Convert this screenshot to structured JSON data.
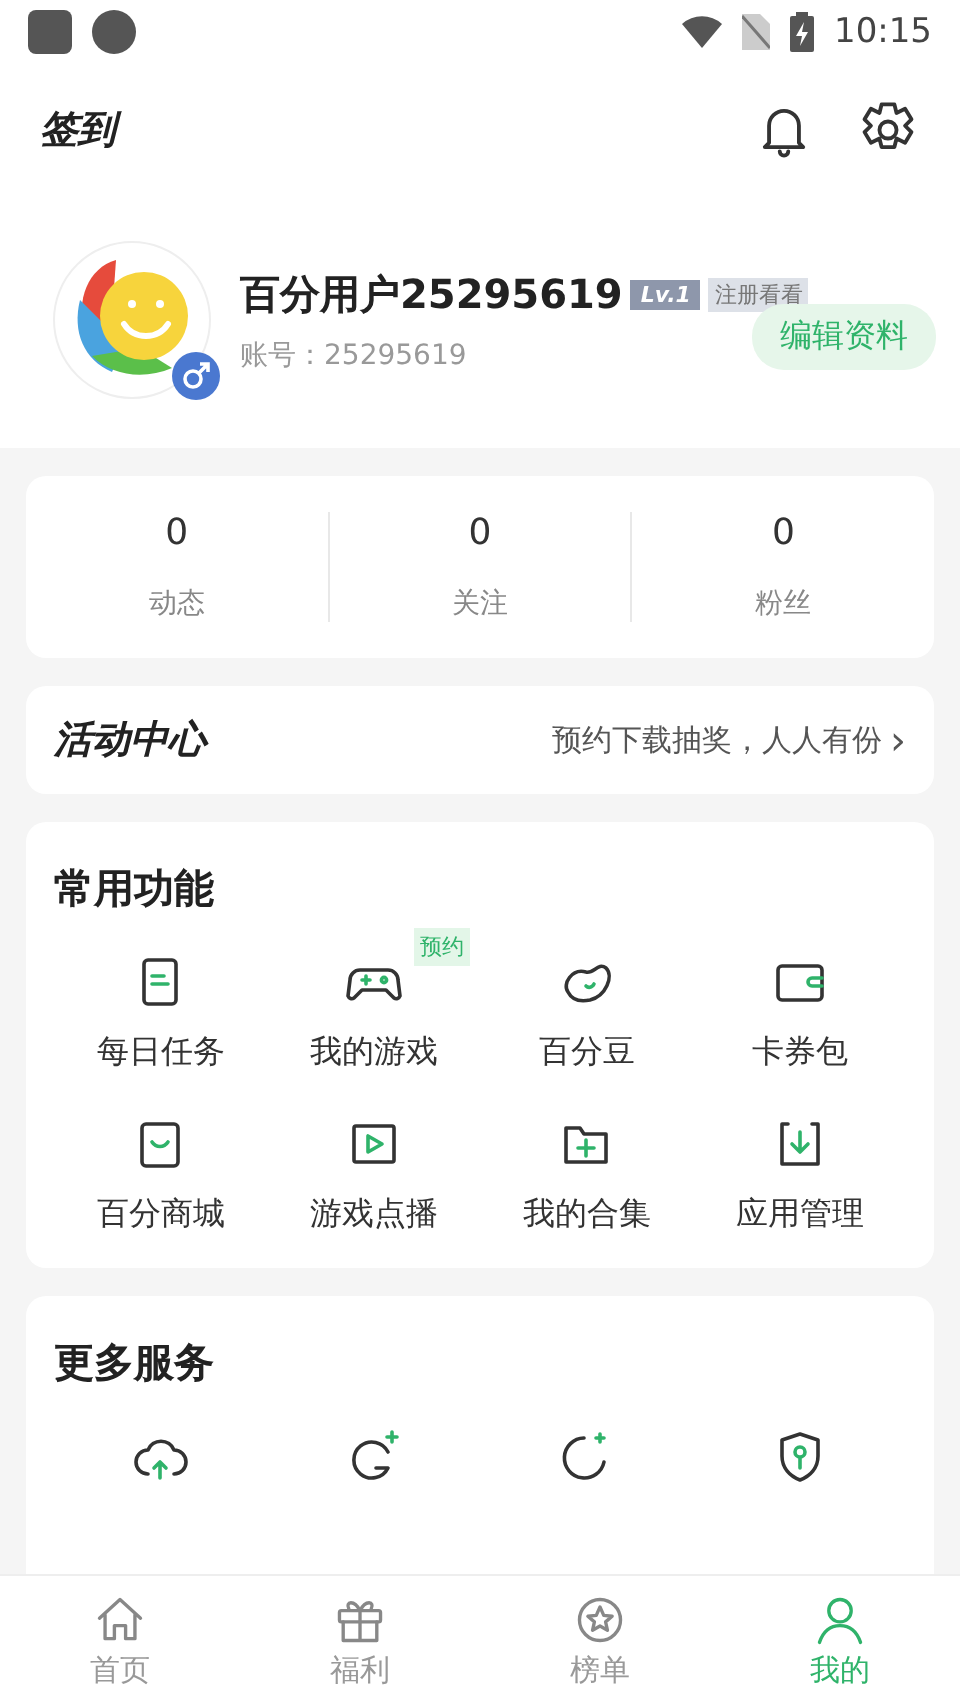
{
  "status_bar": {
    "time": "10:15"
  },
  "header": {
    "checkin": "签到"
  },
  "profile": {
    "name": "百分用户25295619",
    "level": "Lv.1",
    "tag": "注册看看",
    "account": "账号：25295619",
    "edit_button": "编辑资料"
  },
  "stats": [
    {
      "value": "0",
      "label": "动态"
    },
    {
      "value": "0",
      "label": "关注"
    },
    {
      "value": "0",
      "label": "粉丝"
    }
  ],
  "activity": {
    "title": "活动中心",
    "promo": "预约下载抽奖，人人有份",
    "arrow": "›"
  },
  "common_functions": {
    "title": "常用功能",
    "items": [
      {
        "label": "每日任务"
      },
      {
        "label": "我的游戏",
        "badge": "预约"
      },
      {
        "label": "百分豆"
      },
      {
        "label": "卡券包"
      },
      {
        "label": "百分商城"
      },
      {
        "label": "游戏点播"
      },
      {
        "label": "我的合集"
      },
      {
        "label": "应用管理"
      }
    ]
  },
  "more_services": {
    "title": "更多服务"
  },
  "bottom_nav": [
    {
      "label": "首页",
      "selected": false
    },
    {
      "label": "福利",
      "selected": false
    },
    {
      "label": "榜单",
      "selected": false
    },
    {
      "label": "我的",
      "selected": true
    }
  ]
}
